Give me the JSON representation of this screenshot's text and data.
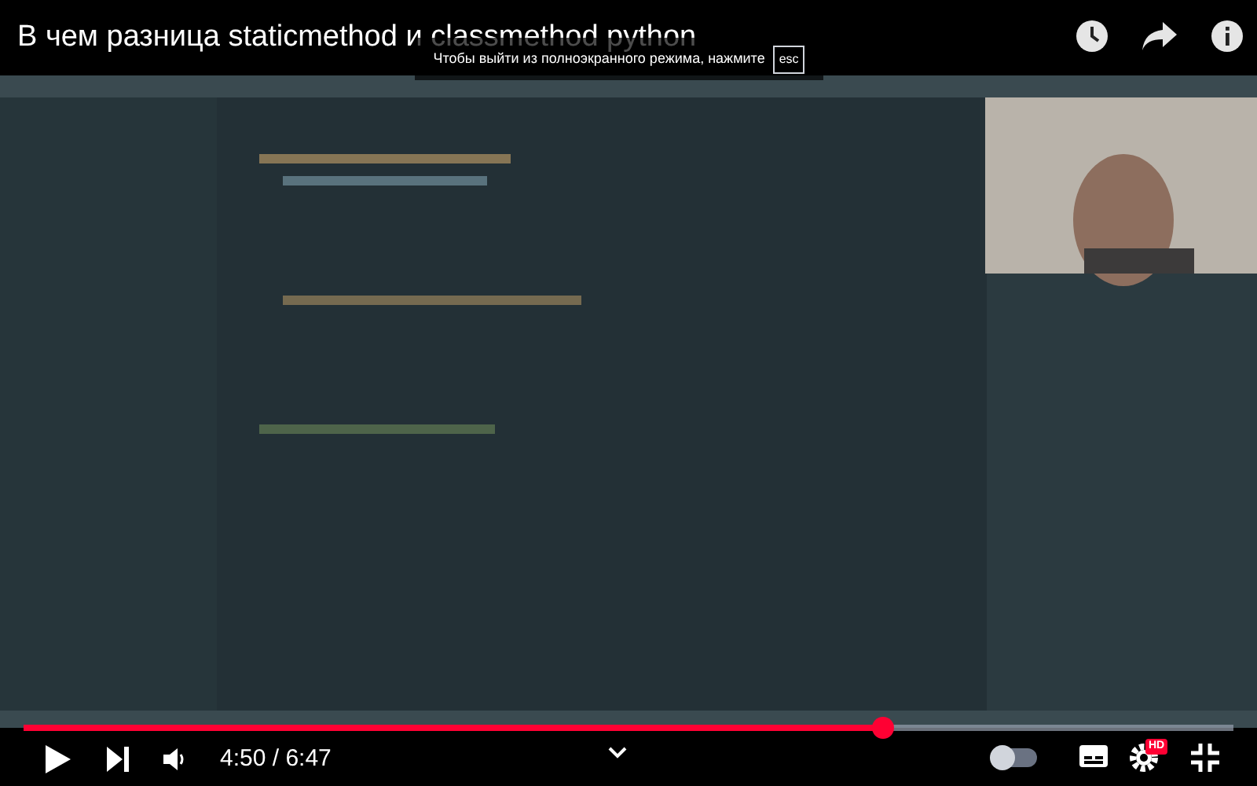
{
  "video": {
    "title": "В чем разница staticmethod и classmethod python"
  },
  "fullscreen_hint": {
    "text": "Чтобы выйти из полноэкранного режима, нажмите",
    "key": "esc"
  },
  "progress": {
    "level": 0.71
  },
  "time": "4:50 / 6:47",
  "autoplay": {
    "on": false
  },
  "quality_badge": "HD"
}
